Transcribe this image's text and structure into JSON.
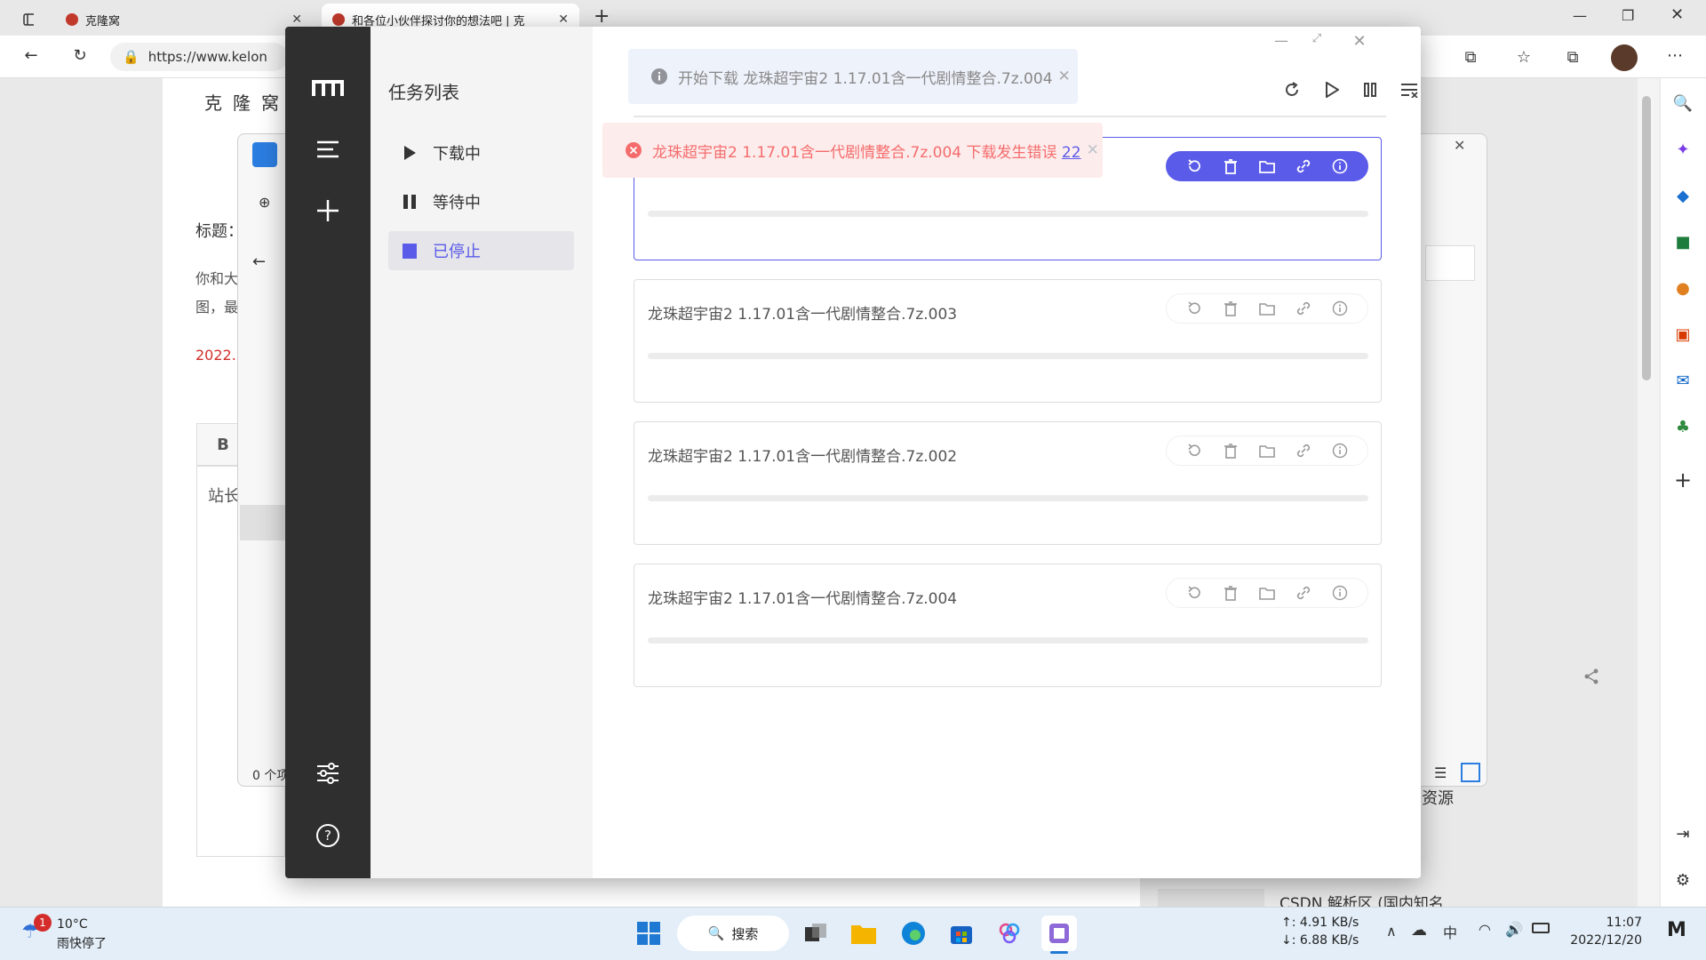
{
  "browser": {
    "tabs": [
      {
        "title": "克隆窝"
      },
      {
        "title": "和各位小伙伴探讨你的想法吧 | 克"
      }
    ],
    "address": "https://www.kelon",
    "new_tab_icon": "plus-icon"
  },
  "page": {
    "site_name": "克隆窝",
    "title_label": "标题：",
    "body_line1": "你和大",
    "body_line2": "图，最",
    "date": "2022.",
    "editor_bold": "B",
    "editor_text": "站长",
    "resource_label": "资源",
    "csdn_text": "CSDN 解析区 (国内知名"
  },
  "explorer": {
    "item_count": "0 个项"
  },
  "motrix": {
    "section_title": "任务列表",
    "nav": [
      {
        "label": "下载中",
        "icon": "play-icon"
      },
      {
        "label": "等待中",
        "icon": "pause-icon"
      },
      {
        "label": "已停止",
        "icon": "stop-icon"
      }
    ],
    "info_toast": "开始下载 龙珠超宇宙2 1.17.01含一代剧情整合.7z.004",
    "error_toast": "龙珠超宇宙2 1.17.01含一代剧情整合.7z.004 下载发生错误",
    "error_code": "22",
    "tasks": [
      {
        "name": ""
      },
      {
        "name": "龙珠超宇宙2 1.17.01含一代剧情整合.7z.003"
      },
      {
        "name": "龙珠超宇宙2 1.17.01含一代剧情整合.7z.002"
      },
      {
        "name": "龙珠超宇宙2 1.17.01含一代剧情整合.7z.004"
      }
    ]
  },
  "taskbar": {
    "weather_temp": "10°C",
    "weather_desc": "雨快停了",
    "weather_badge": "1",
    "search": "搜索",
    "upload": "↑: 4.91 KB/s",
    "download": "↓: 6.88 KB/s",
    "ime": "中",
    "time": "11:07",
    "date": "2022/12/20"
  },
  "colors": {
    "accent": "#5b5bea",
    "nav_bg": "#2f2f2f",
    "error": "#f56c6c",
    "info_bg": "#eef2fb"
  }
}
